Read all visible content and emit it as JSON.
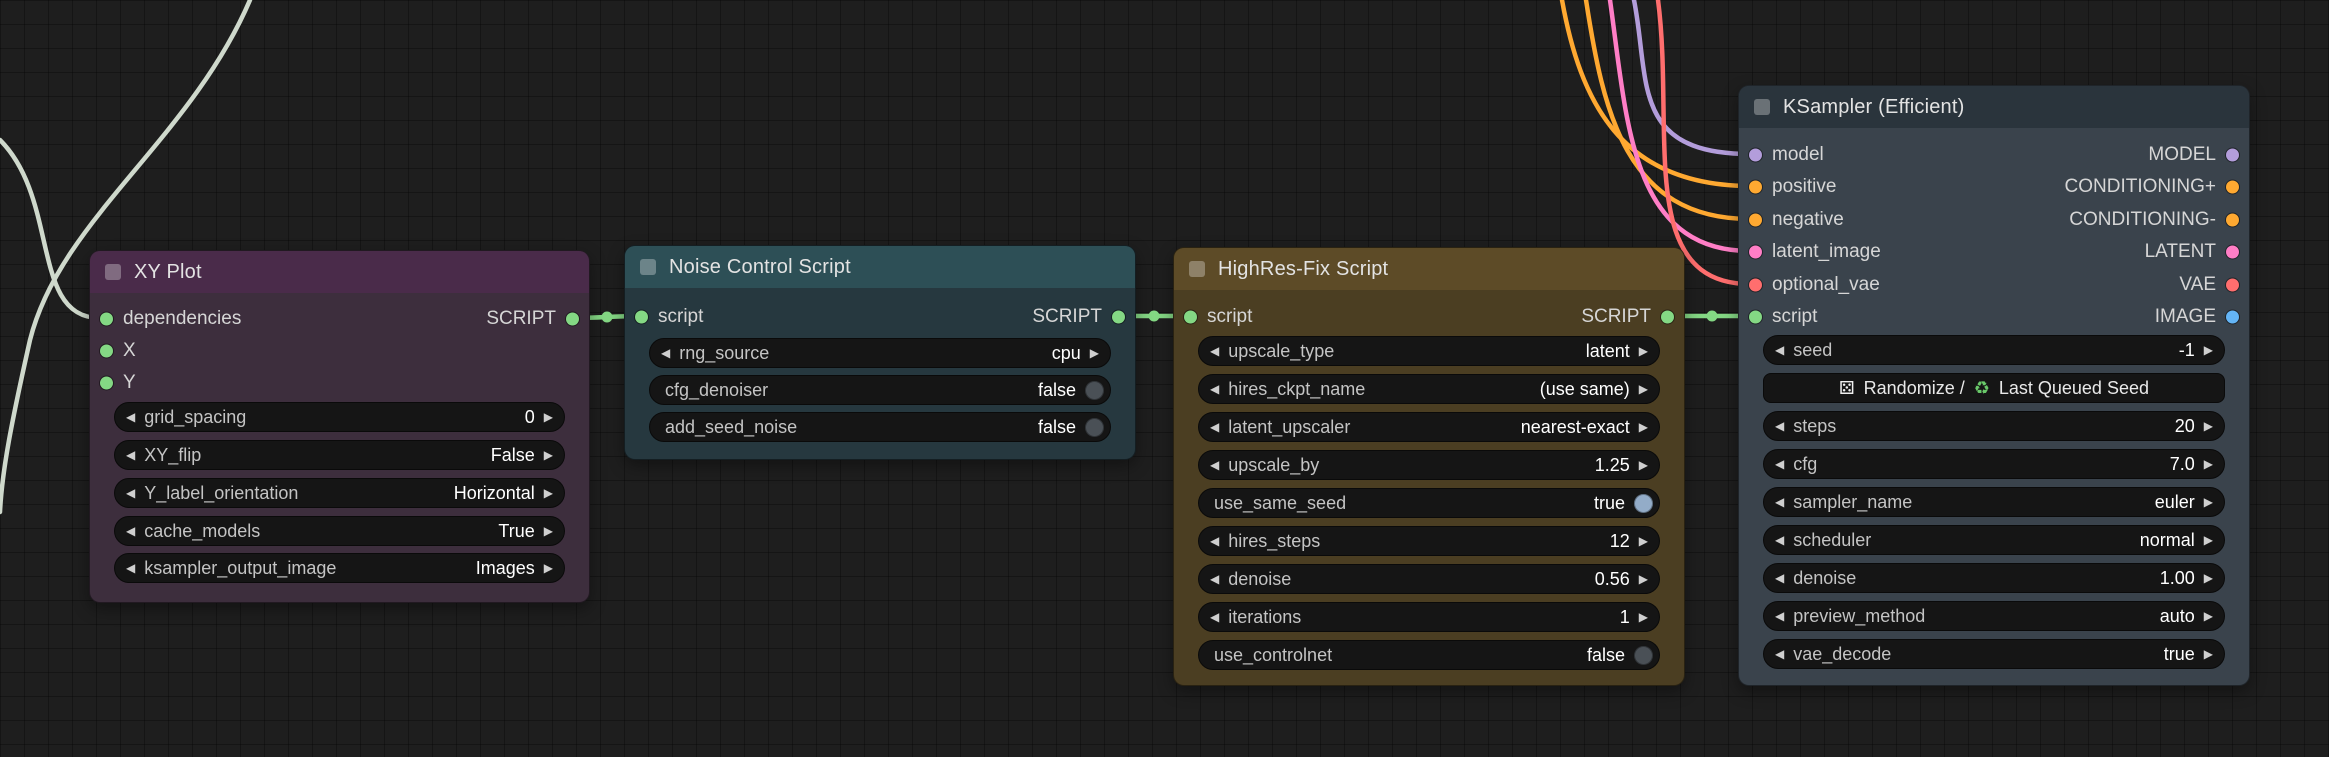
{
  "colors": {
    "script": "#84d884",
    "model": "#b39ddb",
    "conditioning": "#ffa931",
    "latent": "#ff7ec6",
    "vae": "#ff6e6e",
    "image": "#64b5f6",
    "pale_link": "#cfd9cc",
    "toggle_on": "#93acc8"
  },
  "icons": {
    "left_arrow": "◀",
    "right_arrow": "▶"
  },
  "nodes": {
    "xy_plot": {
      "title": "XY Plot",
      "inputs": [
        {
          "label": "dependencies"
        },
        {
          "label": "X"
        },
        {
          "label": "Y"
        }
      ],
      "outputs": [
        {
          "label": "SCRIPT"
        }
      ],
      "widgets": [
        {
          "label": "grid_spacing",
          "value": "0"
        },
        {
          "label": "XY_flip",
          "value": "False"
        },
        {
          "label": "Y_label_orientation",
          "value": "Horizontal"
        },
        {
          "label": "cache_models",
          "value": "True"
        },
        {
          "label": "ksampler_output_image",
          "value": "Images"
        }
      ]
    },
    "noise_control": {
      "title": "Noise Control Script",
      "inputs": [
        {
          "label": "script"
        }
      ],
      "outputs": [
        {
          "label": "SCRIPT"
        }
      ],
      "widgets": [
        {
          "label": "rng_source",
          "value": "cpu"
        },
        {
          "label": "cfg_denoiser",
          "value": "false"
        },
        {
          "label": "add_seed_noise",
          "value": "false"
        }
      ]
    },
    "highres_fix": {
      "title": "HighRes-Fix Script",
      "inputs": [
        {
          "label": "script"
        }
      ],
      "outputs": [
        {
          "label": "SCRIPT"
        }
      ],
      "widgets": [
        {
          "label": "upscale_type",
          "value": "latent"
        },
        {
          "label": "hires_ckpt_name",
          "value": "(use same)"
        },
        {
          "label": "latent_upscaler",
          "value": "nearest-exact"
        },
        {
          "label": "upscale_by",
          "value": "1.25"
        },
        {
          "label": "use_same_seed",
          "value": "true"
        },
        {
          "label": "hires_steps",
          "value": "12"
        },
        {
          "label": "denoise",
          "value": "0.56"
        },
        {
          "label": "iterations",
          "value": "1"
        },
        {
          "label": "use_controlnet",
          "value": "false"
        }
      ]
    },
    "ksampler": {
      "title": "KSampler (Efficient)",
      "rows": [
        {
          "in": "model",
          "out": "MODEL"
        },
        {
          "in": "positive",
          "out": "CONDITIONING+"
        },
        {
          "in": "negative",
          "out": "CONDITIONING-"
        },
        {
          "in": "latent_image",
          "out": "LATENT"
        },
        {
          "in": "optional_vae",
          "out": "VAE"
        },
        {
          "in": "script",
          "out": "IMAGE"
        }
      ],
      "seed_button": {
        "icon1": "⚄",
        "text1": "Randomize /",
        "icon2": "♻",
        "text2": "Last Queued Seed"
      },
      "widgets": [
        {
          "label": "seed",
          "value": "-1"
        },
        {
          "label": "steps",
          "value": "20"
        },
        {
          "label": "cfg",
          "value": "7.0"
        },
        {
          "label": "sampler_name",
          "value": "euler"
        },
        {
          "label": "scheduler",
          "value": "normal"
        },
        {
          "label": "denoise",
          "value": "1.00"
        },
        {
          "label": "preview_method",
          "value": "auto"
        },
        {
          "label": "vae_decode",
          "value": "true"
        }
      ]
    }
  }
}
